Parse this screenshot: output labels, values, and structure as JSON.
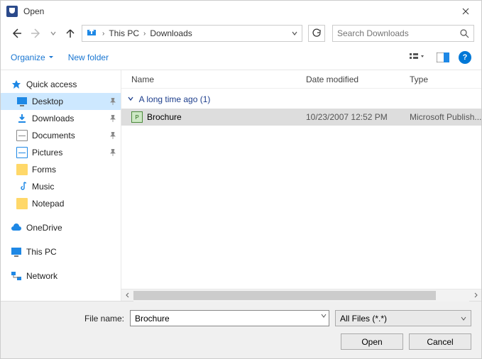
{
  "window": {
    "title": "Open"
  },
  "breadcrumb": {
    "root": "This PC",
    "folder": "Downloads"
  },
  "search": {
    "placeholder": "Search Downloads"
  },
  "toolbar": {
    "organize": "Organize",
    "new_folder": "New folder"
  },
  "sidebar": {
    "quick_access": "Quick access",
    "items": [
      {
        "label": "Desktop",
        "pinned": true,
        "selected": true
      },
      {
        "label": "Downloads",
        "pinned": true
      },
      {
        "label": "Documents",
        "pinned": true
      },
      {
        "label": "Pictures",
        "pinned": true
      },
      {
        "label": "Forms"
      },
      {
        "label": "Music"
      },
      {
        "label": "Notepad"
      }
    ],
    "onedrive": "OneDrive",
    "this_pc": "This PC",
    "network": "Network"
  },
  "columns": {
    "name": "Name",
    "date": "Date modified",
    "type": "Type"
  },
  "group": {
    "header": "A long time ago (1)"
  },
  "files": [
    {
      "name": "Brochure",
      "date": "10/23/2007 12:52 PM",
      "type": "Microsoft Publish..."
    }
  ],
  "footer": {
    "filename_label": "File name:",
    "filename_value": "Brochure",
    "filter": "All Files (*.*)",
    "open": "Open",
    "cancel": "Cancel"
  }
}
